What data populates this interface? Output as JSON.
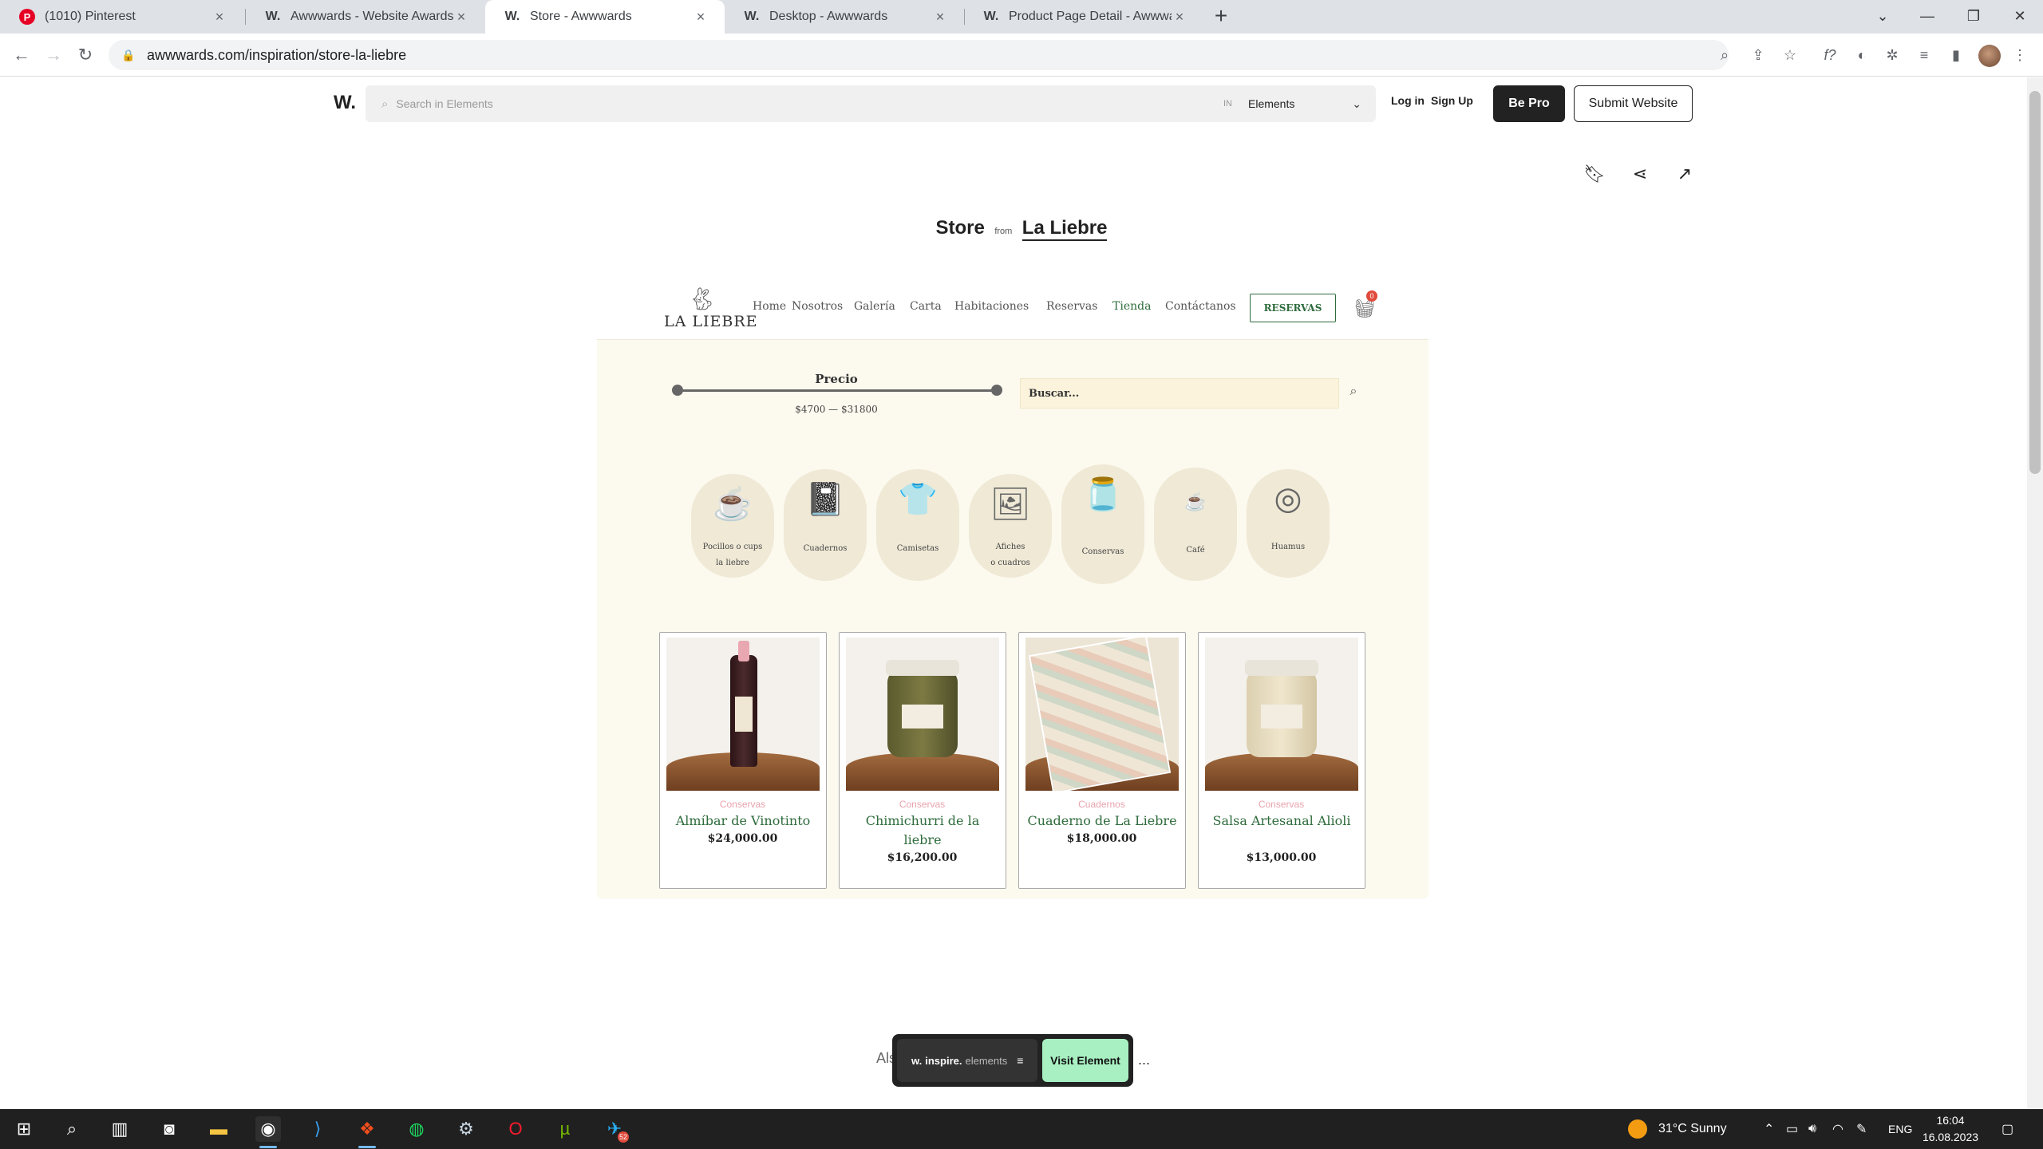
{
  "browser": {
    "tabs": [
      {
        "title": "(1010) Pinterest",
        "icon": "pinterest-icon",
        "glyph": "P",
        "color": "#e60023"
      },
      {
        "title": "Awwwards - Website Awards - Be",
        "icon": "awwwards-icon",
        "glyph": "W.",
        "color": "#222222"
      },
      {
        "title": "Store - Awwwards",
        "icon": "awwwards-icon",
        "glyph": "W.",
        "color": "#222222"
      },
      {
        "title": "Desktop - Awwwards",
        "icon": "awwwards-icon",
        "glyph": "W.",
        "color": "#222222"
      },
      {
        "title": "Product Page Detail - Awwwards",
        "icon": "awwwards-icon",
        "glyph": "W.",
        "color": "#222222"
      }
    ],
    "close_glyph": "×",
    "new_tab_glyph": "+",
    "url": "awwwards.com/inspiration/store-la-liebre"
  },
  "awwwards": {
    "logo": "W.",
    "search_placeholder": "Search in Elements",
    "search_in": "IN",
    "search_scope": "Elements",
    "login": "Log in",
    "signup": "Sign Up",
    "be_pro": "Be Pro",
    "submit": "Submit Website",
    "title": "Store",
    "from": "from",
    "author": "La Liebre"
  },
  "site": {
    "logo_text": "LA LIEBRE",
    "nav": [
      "Home",
      "Nosotros",
      "Galería",
      "Carta",
      "Habitaciones",
      "Reservas",
      "Tienda",
      "Contáctanos"
    ],
    "reservas_button": "RESERVAS",
    "cart_count": "0",
    "price_label": "Precio",
    "price_range": "$4700 — $31800",
    "search_placeholder": "Buscar...",
    "categories": [
      {
        "label": "Pocillos o cups\nla liebre",
        "icon": "mug-icon",
        "glyph": "☕"
      },
      {
        "label": "Cuadernos",
        "icon": "notebook-icon",
        "glyph": "📓"
      },
      {
        "label": "Camisetas",
        "icon": "shirt-icon",
        "glyph": "👕"
      },
      {
        "label": "Afiches\no cuadros",
        "icon": "poster-icon",
        "glyph": "🖼"
      },
      {
        "label": "Conservas",
        "icon": "jar-icon",
        "glyph": "🫙"
      },
      {
        "label": "Café",
        "icon": "coffee-logo-icon",
        "glyph": "☕"
      },
      {
        "label": "Huamus",
        "icon": "bowl-icon",
        "glyph": "◎"
      }
    ],
    "products": [
      {
        "category": "Conservas",
        "name": "Almíbar de Vinotinto",
        "price": "$24,000.00",
        "image": "bottle"
      },
      {
        "category": "Conservas",
        "name": "Chimichurri de la liebre",
        "price": "$16,200.00",
        "image": "jar"
      },
      {
        "category": "Cuadernos",
        "name": "Cuaderno de La Liebre",
        "price": "$18,000.00",
        "image": "notebook"
      },
      {
        "category": "Conservas",
        "name": "Salsa Artesanal Alioli",
        "price": "$13,000.00",
        "image": "jar-light"
      }
    ]
  },
  "floating_bar": {
    "brand": "w.",
    "inspire": "inspire.",
    "elements": "elements",
    "visit": "Visit Element",
    "also_text": "Als",
    "more": "..."
  },
  "taskbar": {
    "weather": "31°C  Sunny",
    "language": "ENG",
    "time": "16:04",
    "date": "16.08.2023",
    "telegram_badge": "52"
  }
}
